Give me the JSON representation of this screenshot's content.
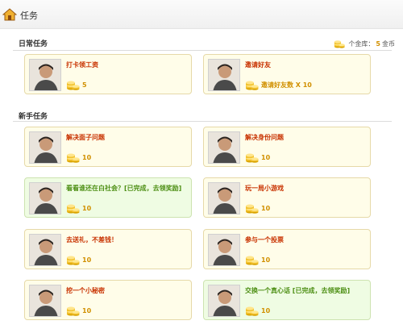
{
  "header": {
    "title": "任务"
  },
  "daily": {
    "section_title": "日常任务",
    "coins_label": "个金库：",
    "coins_value": "5",
    "coins_unit": "金币",
    "tasks": [
      {
        "name": "打卡领工资",
        "reward": "5",
        "done": false
      },
      {
        "name": "邀请好友",
        "reward": "邀请好友数 X 10",
        "done": false
      }
    ]
  },
  "novice": {
    "section_title": "新手任务",
    "tasks": [
      {
        "name": "解决面子问题",
        "reward": "10",
        "done": false
      },
      {
        "name": "解决身份问题",
        "reward": "10",
        "done": false
      },
      {
        "name": "看看谁还在白社会？[已完成，去领奖励]",
        "reward": "10",
        "done": true
      },
      {
        "name": "玩一局小游戏",
        "reward": "10",
        "done": false
      },
      {
        "name": "去送礼，不差钱！",
        "reward": "10",
        "done": false
      },
      {
        "name": "参与一个投票",
        "reward": "10",
        "done": false
      },
      {
        "name": "挖一个小秘密",
        "reward": "10",
        "done": false
      },
      {
        "name": "交换一个真心话 [已完成，去领奖励]",
        "reward": "10",
        "done": true
      }
    ]
  },
  "colors": {
    "task_title": "#c83200",
    "done_title": "#4d8f14",
    "coin": "#d19000",
    "card_bg": "#fffde9",
    "done_bg": "#effce3"
  }
}
